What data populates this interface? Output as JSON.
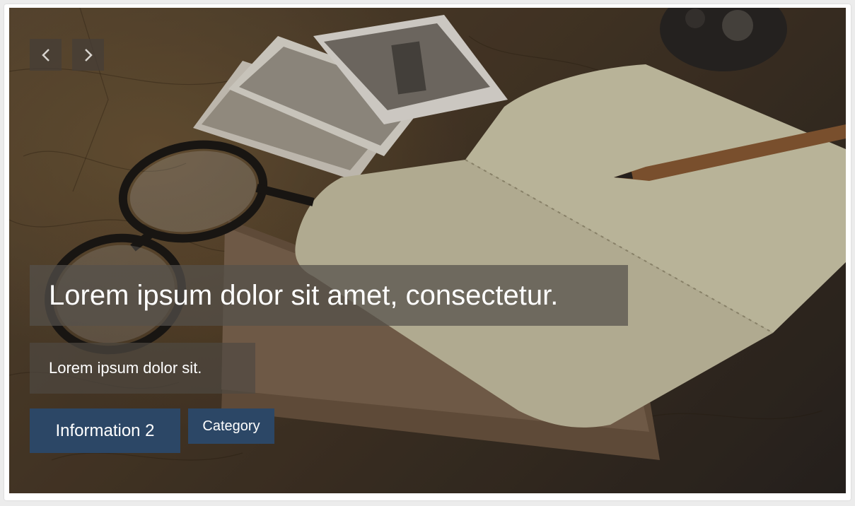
{
  "slider": {
    "prev_icon": "chevron-left-icon",
    "next_icon": "chevron-right-icon",
    "caption": {
      "title": "Lorem ipsum dolor sit amet, consectetur.",
      "subtitle": "Lorem ipsum dolor sit."
    },
    "buttons": {
      "info_label": "Information 2",
      "category_label": "Category"
    },
    "colors": {
      "button_bg": "#2c4766",
      "caption_bg": "#55504b",
      "nav_bg": "#463e37"
    }
  }
}
